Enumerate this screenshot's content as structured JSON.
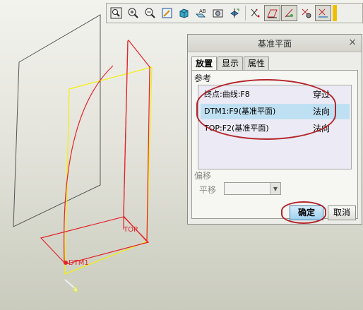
{
  "toolbar": {
    "icons": [
      "zoom-fit-icon",
      "zoom-in-icon",
      "zoom-out-icon",
      "repaint-icon",
      "orient-icon",
      "view-manager-icon",
      "saved-view-icon",
      "spin-center-icon",
      "datum-plane-display-icon",
      "datum-axis-display-icon",
      "datum-point-display-icon",
      "csys-display-icon",
      "annotation-display-icon"
    ],
    "selected": [
      "datum-plane-display-icon",
      "datum-axis-display-icon",
      "annotation-display-icon"
    ]
  },
  "graphics": {
    "label_top": "TOP",
    "label_dtm1": "DTM1"
  },
  "dialog": {
    "title": "基准平面",
    "close": "×",
    "tabs": [
      "放置",
      "显示",
      "属性"
    ],
    "references_label": "参考",
    "references": [
      {
        "name": "终点:曲线:F8",
        "type": "穿过"
      },
      {
        "name": "DTM1:F9(基准平面)",
        "type": "法向"
      },
      {
        "name": "TOP:F2(基准平面)",
        "type": "法向"
      }
    ],
    "offset_label": "偏移",
    "translate_label": "平移",
    "translate_value": "",
    "ok_label": "确定",
    "cancel_label": "取消"
  },
  "colors": {
    "selection_highlight": "#bfe0f2",
    "callout": "#b3262c",
    "datum": "#e3232a",
    "preview": "#f2f200"
  }
}
